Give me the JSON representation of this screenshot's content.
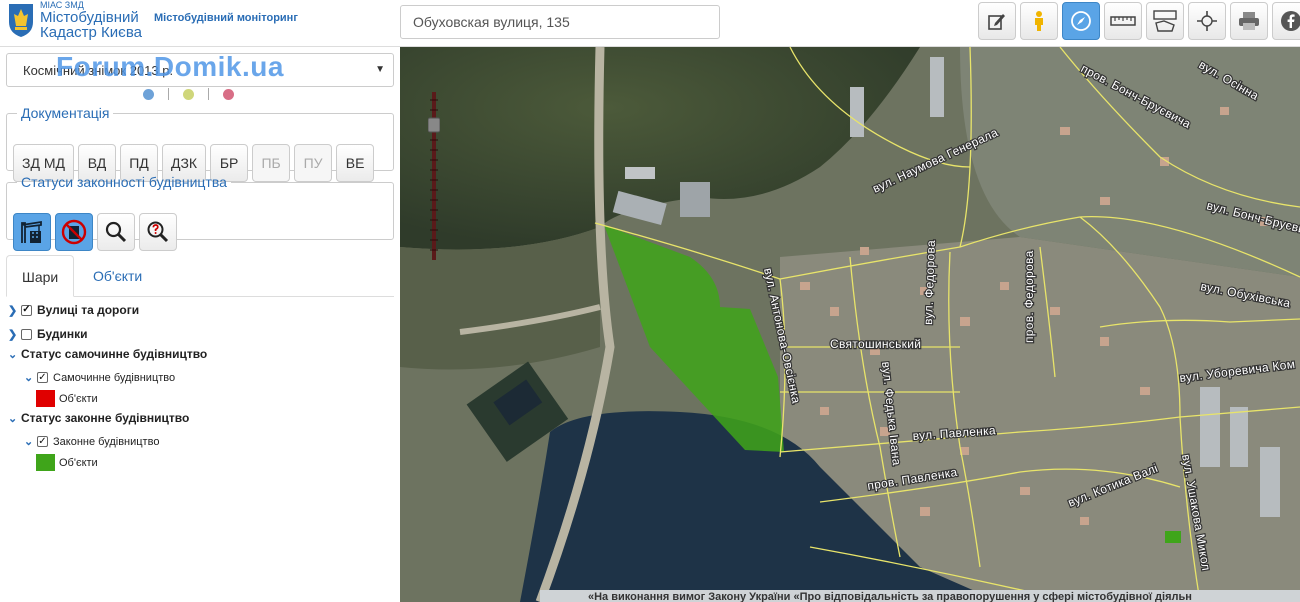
{
  "header": {
    "brand_small": "МІАС ЗМД",
    "brand_line1": "Містобудівний",
    "brand_line2": "Кадастр Києва",
    "brand_sub": "Містобудівний моніторинг"
  },
  "search": {
    "value": "Обуховская вулиця, 135"
  },
  "toolbar": [
    {
      "icon": "edit-icon",
      "active": false
    },
    {
      "icon": "person-icon",
      "active": false
    },
    {
      "icon": "compass-icon",
      "active": true
    },
    {
      "icon": "ruler-icon",
      "active": false
    },
    {
      "icon": "area-measure-icon",
      "active": false
    },
    {
      "icon": "crosshair-icon",
      "active": false
    },
    {
      "icon": "print-icon",
      "active": false
    },
    {
      "icon": "facebook-icon",
      "active": false
    }
  ],
  "basemap": {
    "selected": "Космічний знімок 2013 р.",
    "watermark": "Forum.Domik.ua",
    "dot_colors": [
      "#6ea2d8",
      "#cfd67a",
      "#d86e86"
    ]
  },
  "documentation": {
    "legend": "Документація",
    "buttons": [
      {
        "label": "ЗД МД",
        "enabled": true
      },
      {
        "label": "ВД",
        "enabled": true
      },
      {
        "label": "ПД",
        "enabled": true
      },
      {
        "label": "ДЗК",
        "enabled": true
      },
      {
        "label": "БР",
        "enabled": true
      },
      {
        "label": "ПБ",
        "enabled": false
      },
      {
        "label": "ПУ",
        "enabled": false
      },
      {
        "label": "ВЕ",
        "enabled": true
      }
    ]
  },
  "legality": {
    "legend": "Статуси законності будівництва",
    "buttons": [
      {
        "icon": "crane-icon",
        "active": true
      },
      {
        "icon": "no-building-icon",
        "active": true
      },
      {
        "icon": "magnifier-icon",
        "active": false
      },
      {
        "icon": "question-magnifier-icon",
        "active": false
      }
    ]
  },
  "tabs": [
    {
      "label": "Шари"
    },
    {
      "label": "Об'єкти"
    }
  ],
  "layers": {
    "streets": "Вулиці та дороги",
    "buildings": "Будинки",
    "illegal_group": "Статус самочинне будівництво",
    "illegal_layer": "Самочинне будівництво",
    "illegal_objects": "Об'єкти",
    "illegal_color": "#e00000",
    "legal_group": "Статус законне будівництво",
    "legal_layer": "Законне будівництво",
    "legal_objects": "Об'єкти",
    "legal_color": "#3fa51a"
  },
  "map": {
    "street_labels": {
      "naumova": "вул. Наумова Генерала",
      "bonch1": "пров. Бонч-Бруєвича",
      "osinna": "вул. Осінна",
      "bonch2": "вул. Бонч-Бруєвича",
      "obukhivska": "вул. Обухівська",
      "antonova": "вул. Антонова-Овсієнка",
      "fedorova1": "вул. Федорова",
      "fedorova2": "пров. Федорова",
      "sviatoshynskyi": "Святошинський",
      "uborevycha": "вул. Уборевича Ком",
      "fedka": "вул. Федька Івана",
      "pavlenka1": "вул. Павленка",
      "pavlenka2": "пров. Павленка",
      "kotyka": "вул. Котика Валі",
      "ushakova": "вул. Ушакова Микол"
    },
    "banner": "«На виконання вимог Закону України «Про відповідальність за правопорушення у сфері містобудівної діяльн"
  }
}
